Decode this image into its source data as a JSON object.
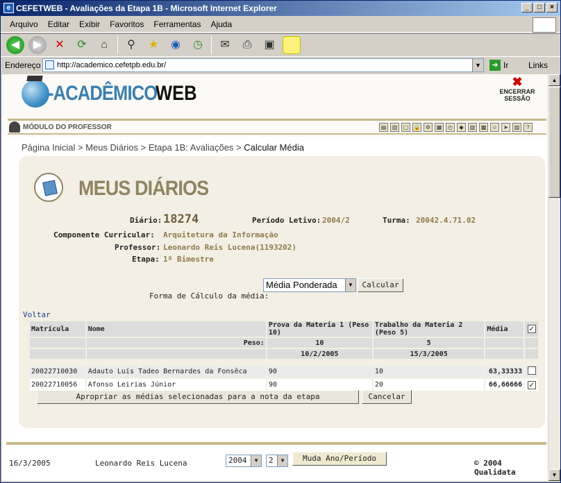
{
  "window": {
    "title": "CEFETWEB - Avaliações da Etapa 1B - Microsoft Internet Explorer",
    "controls": [
      "_",
      "□",
      "×"
    ]
  },
  "menu": [
    "Arquivo",
    "Editar",
    "Exibir",
    "Favoritos",
    "Ferramentas",
    "Ajuda"
  ],
  "address": {
    "label": "Endereço",
    "url": "http://academico.cefetpb.edu.br/",
    "go": "Ir",
    "links": "Links"
  },
  "site": {
    "logo_part1": "-ACADÊMICO",
    "logo_part2": "WEB",
    "logout_line1": "ENCERRAR",
    "logout_line2": "SESSÃO",
    "module": "MÓDULO DO PROFESSOR"
  },
  "breadcrumb": {
    "path": "Página Inicial > Meus Diários > Etapa 1B: Avaliações > ",
    "current": "Calcular Média"
  },
  "page": {
    "title": "MEUS DIÁRIOS",
    "diario_label": "Diário:",
    "diario_value": "18274",
    "periodo_label": "Período Letivo:",
    "periodo_value": "2004/2",
    "turma_label": "Turma:",
    "turma_value": "20042.4.71.02",
    "componente_label": "Componente Curricular:",
    "componente_value": "Arquitetura da Informação",
    "professor_label": "Professor:",
    "professor_value": "Leonardo Reis Lucena(1193202)",
    "etapa_label": "Etapa:",
    "etapa_value": "1º Bimestre"
  },
  "calc": {
    "label": "Forma de Cálculo da média:",
    "selected": "Média Ponderada",
    "button": "Calcular"
  },
  "voltar": "Voltar",
  "table": {
    "headers": [
      "Matrícula",
      "Nome",
      "Prova da Materia 1 (Peso 10)",
      "Trabalho da Materia 2 (Peso 5)",
      "Média"
    ],
    "peso_label": "Peso:",
    "pesos": [
      "10",
      "5"
    ],
    "datas": [
      "10/2/2005",
      "15/3/2005"
    ],
    "rows": [
      {
        "matricula": "20022710030",
        "nome": "Adauto Luís Tadeo Bernardes da Fonsêca",
        "nota1": "90",
        "nota2": "10",
        "media": "63,33333",
        "checked": ""
      },
      {
        "matricula": "20022710056",
        "nome": "Afonso Leirias Júnior",
        "nota1": "90",
        "nota2": "20",
        "media": "66,66666",
        "checked": "✓"
      }
    ],
    "header_check": "✓"
  },
  "actions": {
    "apply": "Apropriar as médias selecionadas para a nota da etapa",
    "cancel": "Cancelar"
  },
  "footer": {
    "date": "16/3/2005",
    "user": "Leonardo Reis Lucena",
    "year": "2004",
    "period": "2",
    "change_button": "Muda Ano/Período",
    "copyright": "© 2004 Qualidata"
  }
}
